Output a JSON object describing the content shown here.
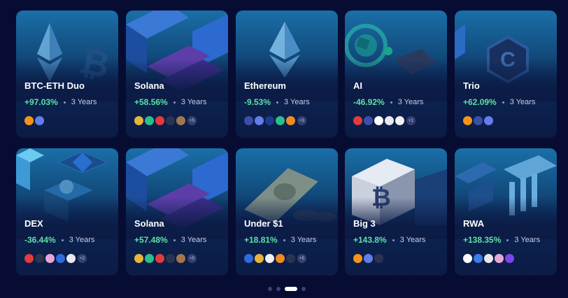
{
  "cards": [
    {
      "title": "BTC-ETH Duo",
      "change": "+97.03%",
      "period": "3 Years",
      "coins": [
        "btc-icon",
        "eth-icon"
      ],
      "more": ""
    },
    {
      "title": "Solana",
      "change": "+58.56%",
      "period": "3 Years",
      "coins": [
        "coin-gold-icon",
        "coin-green-icon",
        "coin-red-icon",
        "coin-stripe-icon",
        "coin-brown-icon"
      ],
      "more": "+5"
    },
    {
      "title": "Ethereum",
      "change": "-9.53%",
      "period": "3 Years",
      "coins": [
        "coin-c-icon",
        "eth-icon",
        "coin-ring-icon",
        "coin-green-icon",
        "fox-icon"
      ],
      "more": "+3"
    },
    {
      "title": "AI",
      "change": "-46.92%",
      "period": "3 Years",
      "coins": [
        "coin-red-icon",
        "coin-c-icon",
        "coin-x-icon",
        "coin-grey-icon",
        "coin-t-icon"
      ],
      "more": "+1"
    },
    {
      "title": "Trio",
      "change": "+62.09%",
      "period": "3 Years",
      "coins": [
        "btc-icon",
        "coin-c-icon",
        "eth-icon"
      ],
      "more": ""
    },
    {
      "title": "DEX",
      "change": "-36.44%",
      "period": "3 Years",
      "coins": [
        "coin-red-icon",
        "coin-stripe-icon",
        "coin-pink-icon",
        "coin-blue-icon",
        "coin-grey-icon"
      ],
      "more": "+2"
    },
    {
      "title": "Solana",
      "change": "+57.48%",
      "period": "3 Years",
      "coins": [
        "coin-gold-icon",
        "coin-green-icon",
        "coin-red-icon",
        "coin-stripe-icon",
        "coin-brown-icon"
      ],
      "more": "+5"
    },
    {
      "title": "Under $1",
      "change": "+18.81%",
      "period": "3 Years",
      "coins": [
        "coin-blue-icon",
        "coin-gold-icon",
        "coin-h-icon",
        "fox-icon",
        "coin-stripe-icon"
      ],
      "more": "+5"
    },
    {
      "title": "Big 3",
      "change": "+143.8%",
      "period": "3 Years",
      "coins": [
        "btc-icon",
        "eth-icon",
        "coin-stripe-icon"
      ],
      "more": ""
    },
    {
      "title": "RWA",
      "change": "+138.35%",
      "period": "3 Years",
      "coins": [
        "coin-at-icon",
        "coin-drop-icon",
        "coin-grey-icon",
        "coin-pink-icon",
        "coin-purple-icon"
      ],
      "more": ""
    }
  ],
  "coin_colors": {
    "btc-icon": "#f7931a",
    "eth-icon": "#627eea",
    "coin-gold-icon": "#e8b33b",
    "coin-green-icon": "#2bbf8a",
    "coin-red-icon": "#e23b3b",
    "coin-stripe-icon": "#2a3450",
    "coin-brown-icon": "#a3764d",
    "coin-c-icon": "#3b4fa8",
    "coin-ring-icon": "#1e3b8e",
    "fox-icon": "#f08a24",
    "coin-x-icon": "#ffffff",
    "coin-grey-icon": "#e8e8ee",
    "coin-t-icon": "#f1f1f1",
    "coin-pink-icon": "#e6a7d8",
    "coin-blue-icon": "#2f6bdc",
    "coin-h-icon": "#f1f1f1",
    "coin-at-icon": "#ffffff",
    "coin-drop-icon": "#3a7ce8",
    "coin-purple-icon": "#7b46e8"
  },
  "pagination": {
    "pages": 4,
    "active": 2
  }
}
